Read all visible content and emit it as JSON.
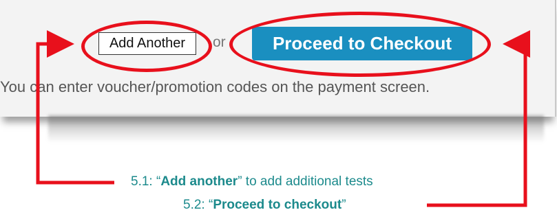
{
  "screen": {
    "add_another_label": "Add Another",
    "or_text": "or",
    "checkout_label": "Proceed to Checkout",
    "voucher_text": "You can enter voucher/promotion codes on the payment screen."
  },
  "annotations": {
    "caption1": {
      "prefix": "5.1: “",
      "bold": "Add another",
      "suffix": "” to add additional tests"
    },
    "caption2": {
      "prefix": "5.2: “",
      "bold": "Proceed to checkout",
      "suffix": "”"
    }
  },
  "colors": {
    "annotation_red": "#e8101c",
    "button_blue": "#1a8fc0",
    "caption_teal": "#1c8a8c"
  }
}
